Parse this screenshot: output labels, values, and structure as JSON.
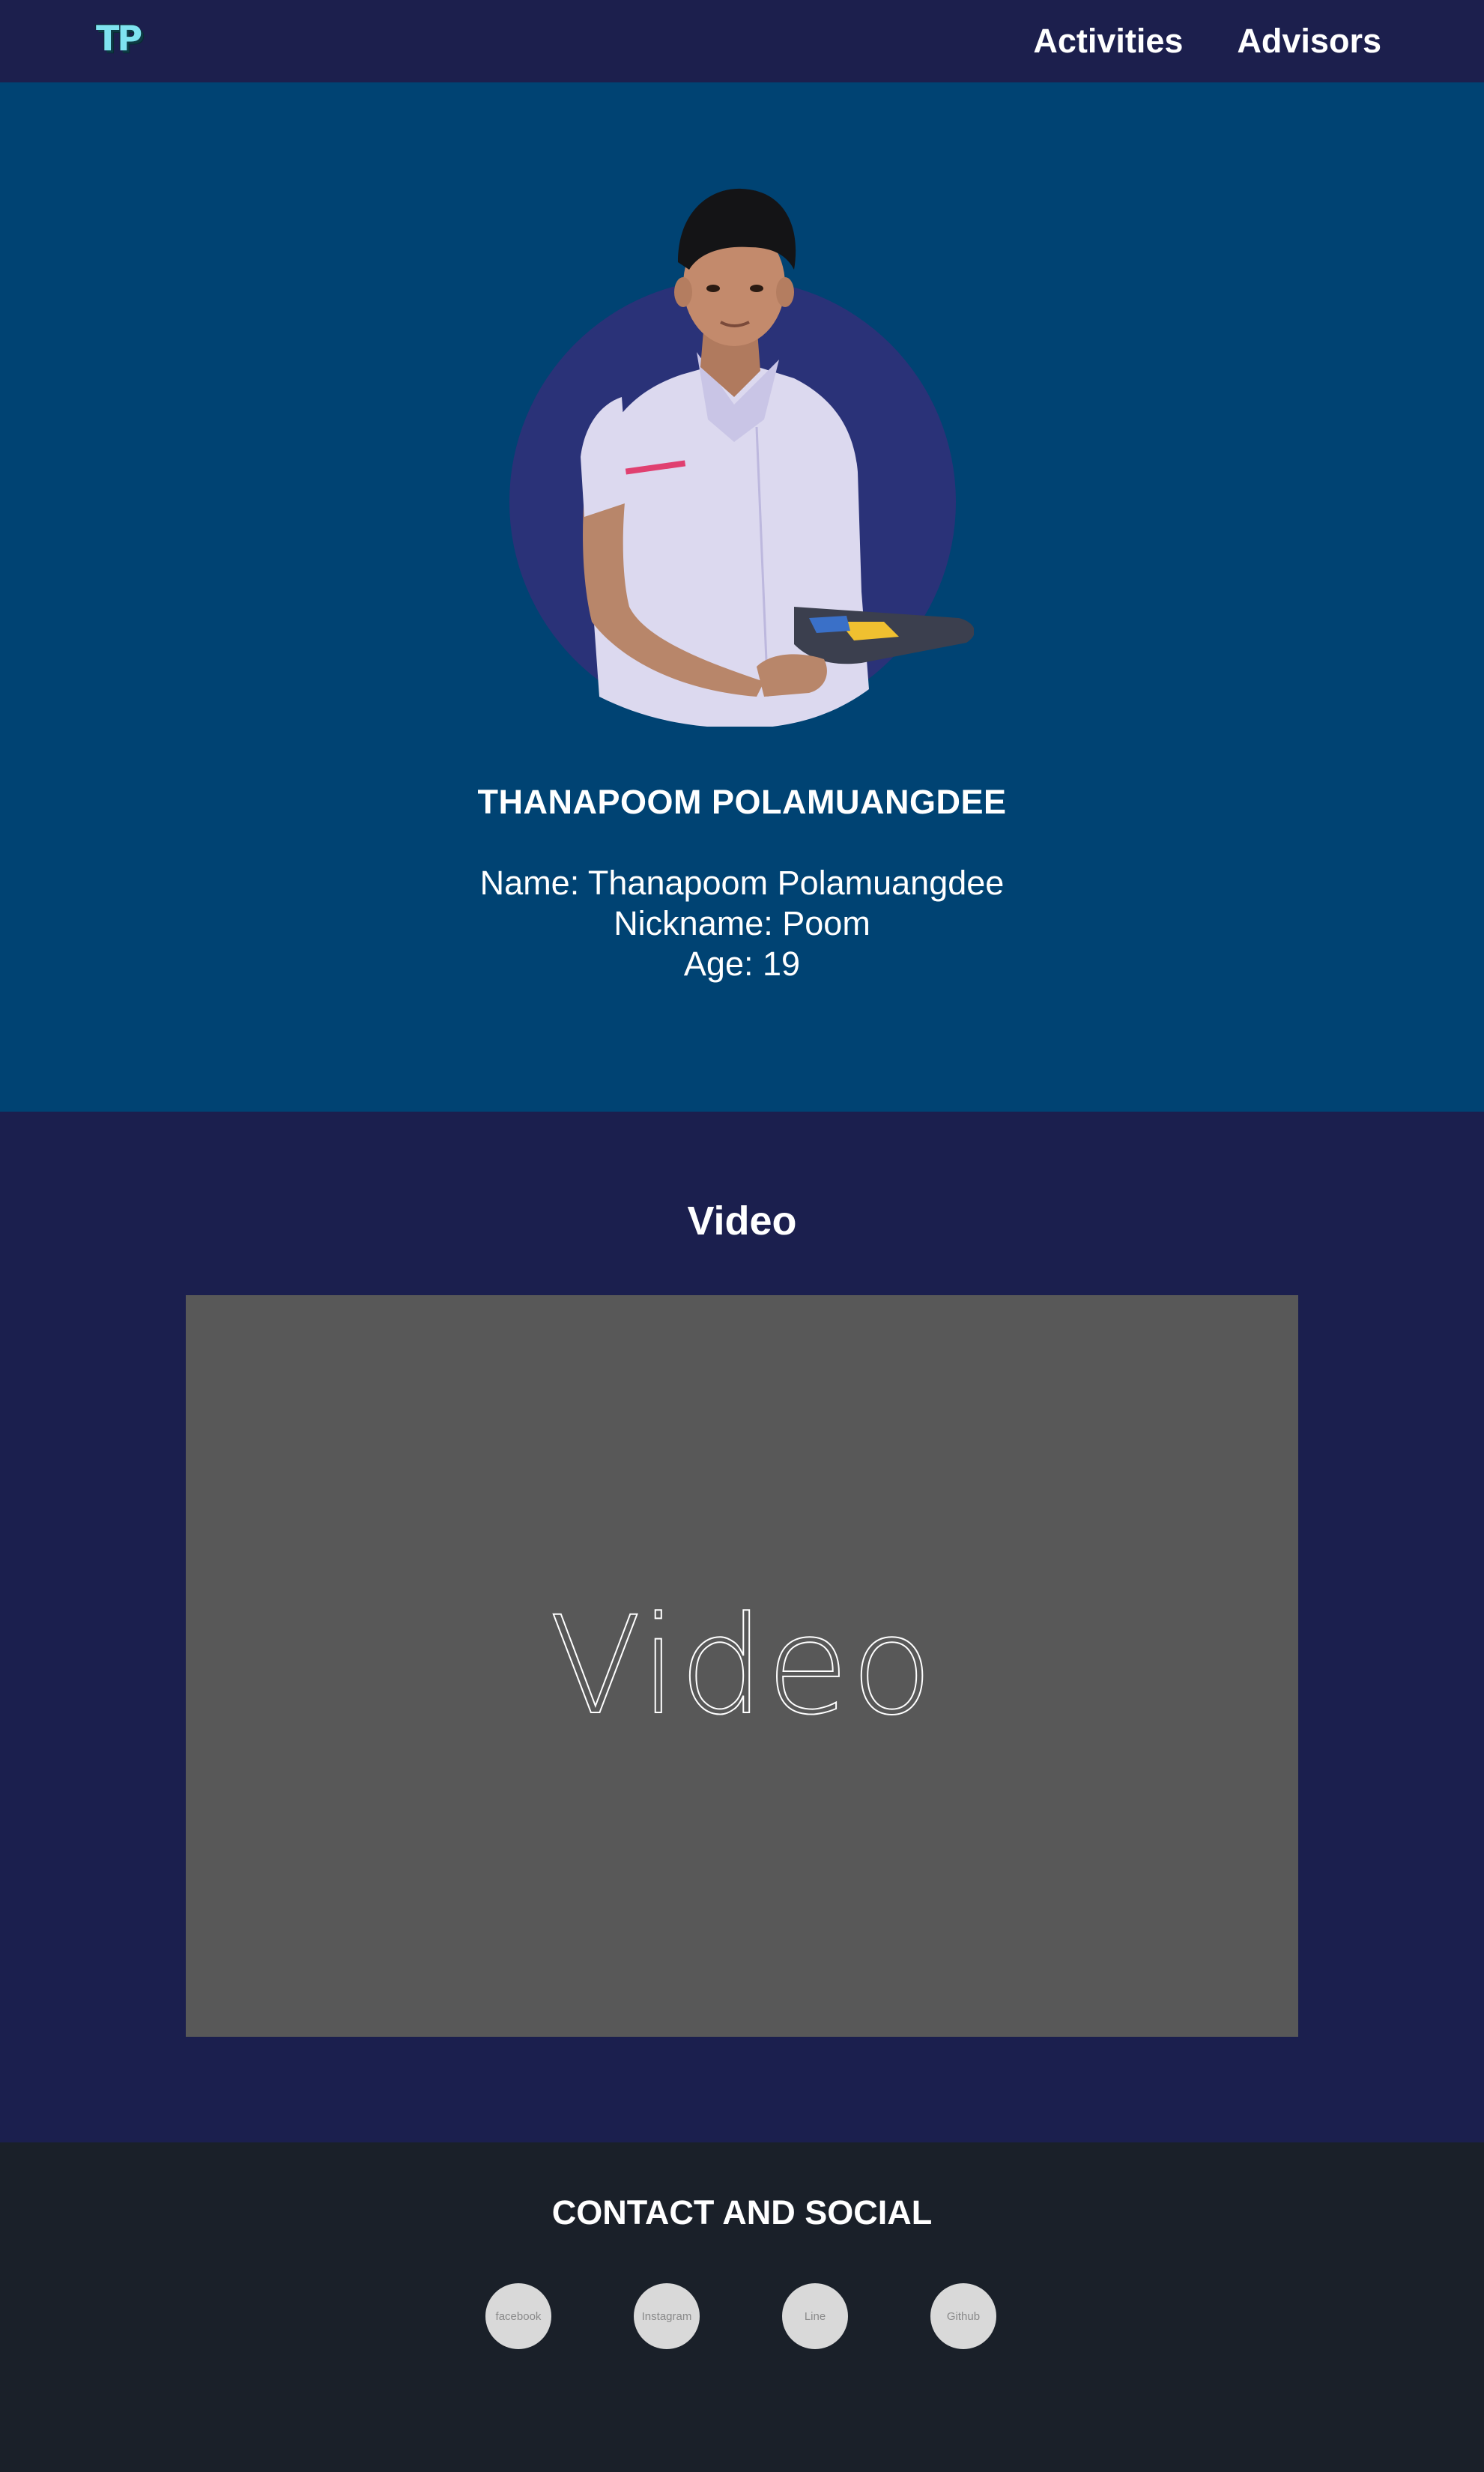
{
  "nav": {
    "logo_text": "TP",
    "links": [
      "Activities",
      "Advisors"
    ]
  },
  "hero": {
    "portrait_icon": "student-portrait",
    "heading": "THANAPOOM POLAMUANGDEE",
    "details": {
      "name": "Name: Thanapoom Polamuangdee",
      "nickname": "Nickname: Poom",
      "age": "Age: 19"
    }
  },
  "video": {
    "title": "Video",
    "placeholder": "Video"
  },
  "contact": {
    "title": "CONTACT AND SOCIAL",
    "socials": [
      "facebook",
      "Instagram",
      "Line",
      "Github"
    ]
  },
  "colors": {
    "nav_bg": "#1c1f4d",
    "hero_bg": "#004373",
    "avatar_circle": "#2a3278",
    "video_section_bg": "#1b1f4e",
    "video_box": "#585858",
    "contact_bg": "#1a2029",
    "social_button": "#d9d9d9"
  }
}
